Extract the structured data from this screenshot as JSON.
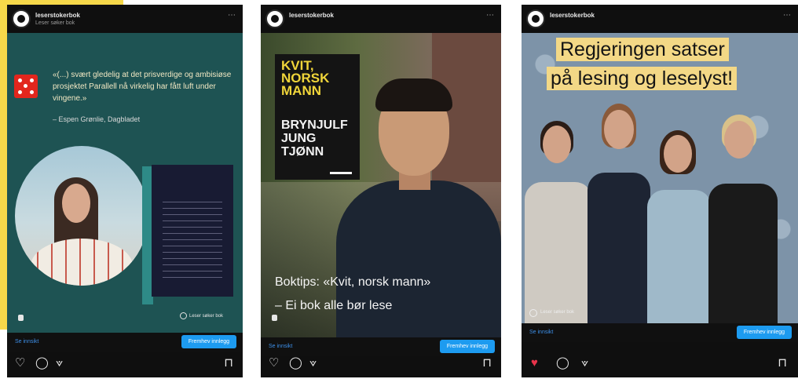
{
  "posts": [
    {
      "account": "leserstokerbok",
      "subline": "Leser søker bok",
      "quote": "«(...) svært gledelig at det prisverdige og ambisiøse prosjektet Parallell nå virkelig har fått luft under vingene.»",
      "attribution": "– Espen Grønlie, Dagbladet",
      "music_tag": "Leser søker bok",
      "see_more": "Se innsikt",
      "cta": "Fremhev innlegg",
      "liked": false
    },
    {
      "account": "leserstokerbok",
      "cover_title": "KVIT,\nNORSK\nMANN",
      "cover_author": "BRYNJULF\nJUNG\nTJØNN",
      "caption": "Boktips: «Kvit, norsk mann»\n– Ei bok alle bør lese",
      "see_more": "Se innsikt",
      "cta": "Fremhev innlegg",
      "liked": false
    },
    {
      "account": "leserstokerbok",
      "headline_1": "Regjeringen satser",
      "headline_2": "på lesing og leselyst!",
      "music_tag": "Leser søker bok",
      "see_more": "Se innsikt",
      "cta": "Fremhev innlegg",
      "liked": true
    }
  ],
  "icons": {
    "more": "⋯",
    "heart_outline": "♡",
    "heart_filled": "♥",
    "comment": "◯",
    "share": "⟇",
    "bookmark": "⊓"
  },
  "colors": {
    "accent_yellow": "#f6d84a",
    "post1_bg": "#1e5353",
    "cta_blue": "#1d9bf0",
    "link_blue": "#3d8fe8",
    "like_red": "#e8334a",
    "headline_bg": "#f3d886"
  }
}
